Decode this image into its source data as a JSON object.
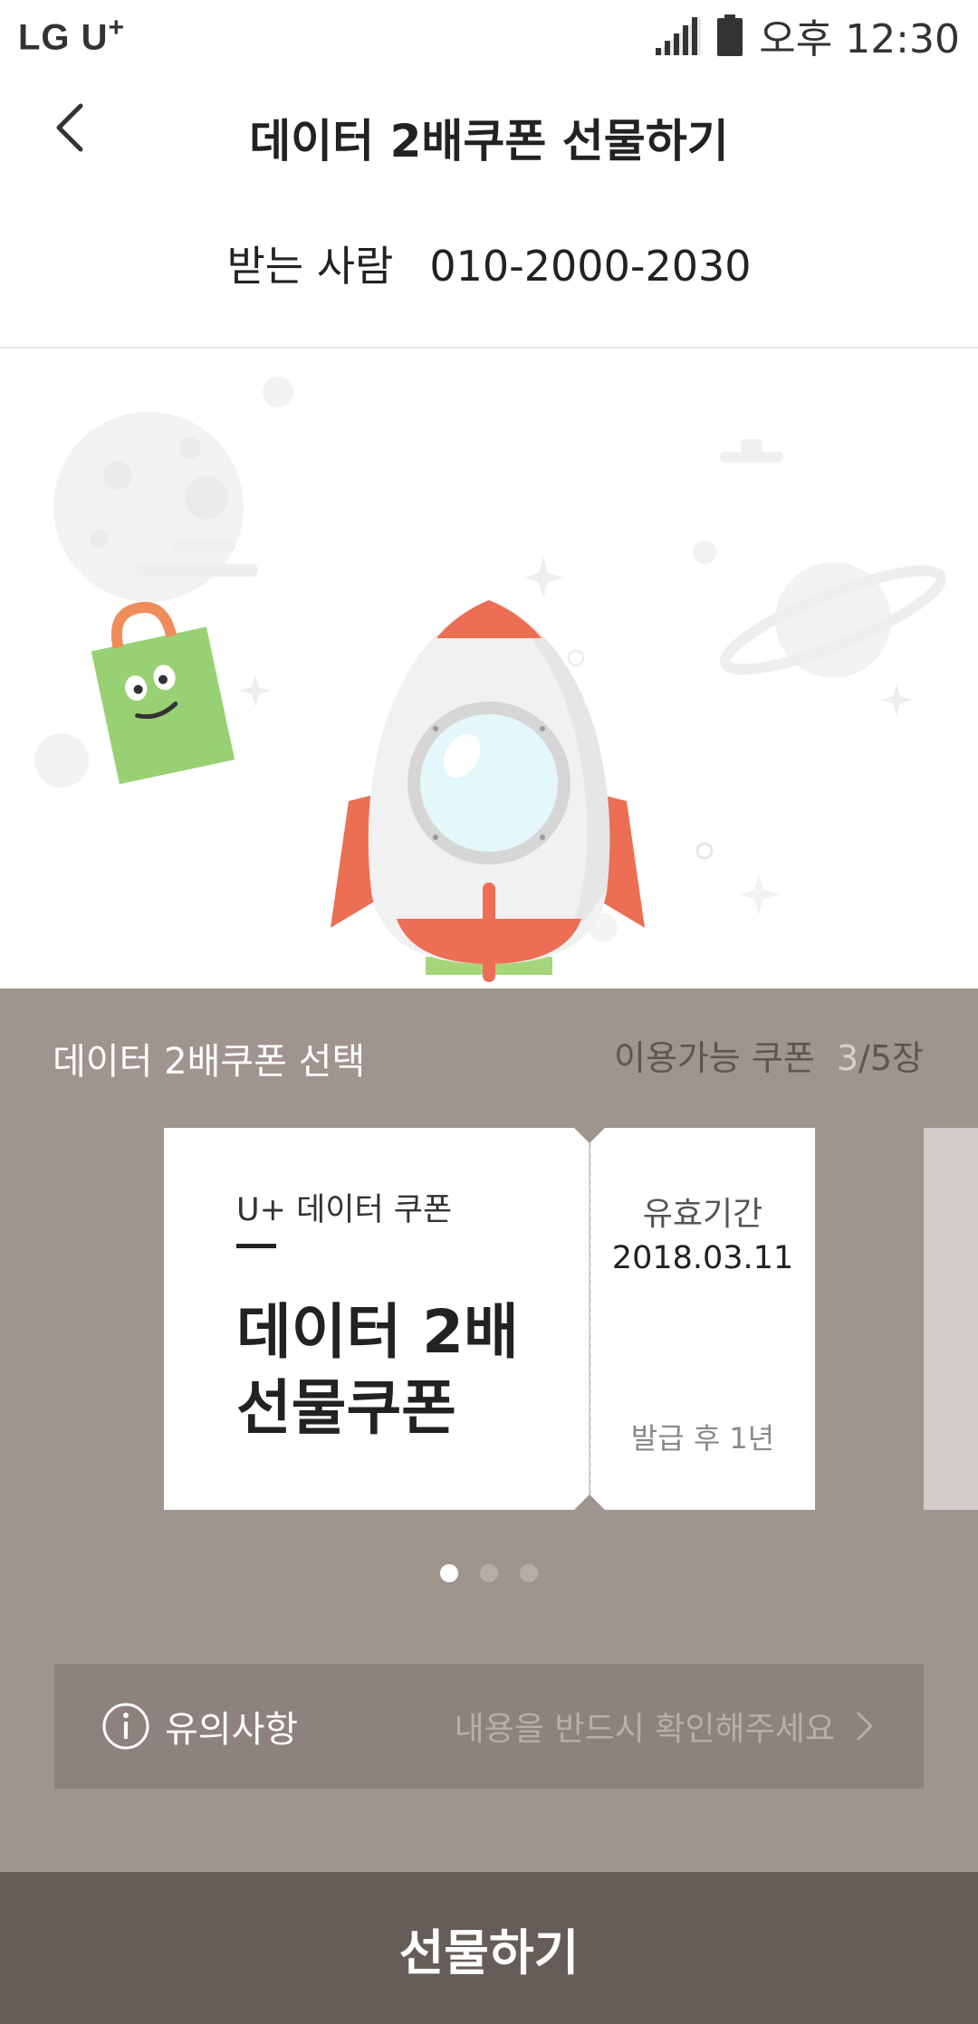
{
  "status_bar": {
    "carrier": "LG U",
    "carrier_plus": "+",
    "time": "오후 12:30"
  },
  "header": {
    "title": "데이터 2배쿠폰 선물하기"
  },
  "recipient": {
    "label": "받는 사람",
    "phone": "010-2000-2030"
  },
  "coupon_section": {
    "title": "데이터 2배쿠폰 선택",
    "available_label": "이용가능 쿠폰",
    "available_current": "3",
    "available_total": "/5장",
    "coupon": {
      "category": "U+ 데이터 쿠폰",
      "name_line1": "데이터 2배",
      "name_line2": "선물쿠폰",
      "validity_label": "유효기간",
      "validity_date": "2018.03.11",
      "validity_note": "발급 후 1년"
    },
    "pager": {
      "total": 3,
      "active": 1
    }
  },
  "notice": {
    "title": "유의사항",
    "description": "내용을 반드시 확인해주세요"
  },
  "gift_button": {
    "label": "선물하기"
  },
  "colors": {
    "section_bg": "#a0948f",
    "notice_bg": "#8e827e",
    "button_bg": "#665c58",
    "rocket_accent": "#ec6e54",
    "gift_green": "#98d173"
  },
  "icons": [
    "signal-icon",
    "battery-icon",
    "back-arrow-icon",
    "info-icon",
    "chevron-right-icon"
  ]
}
